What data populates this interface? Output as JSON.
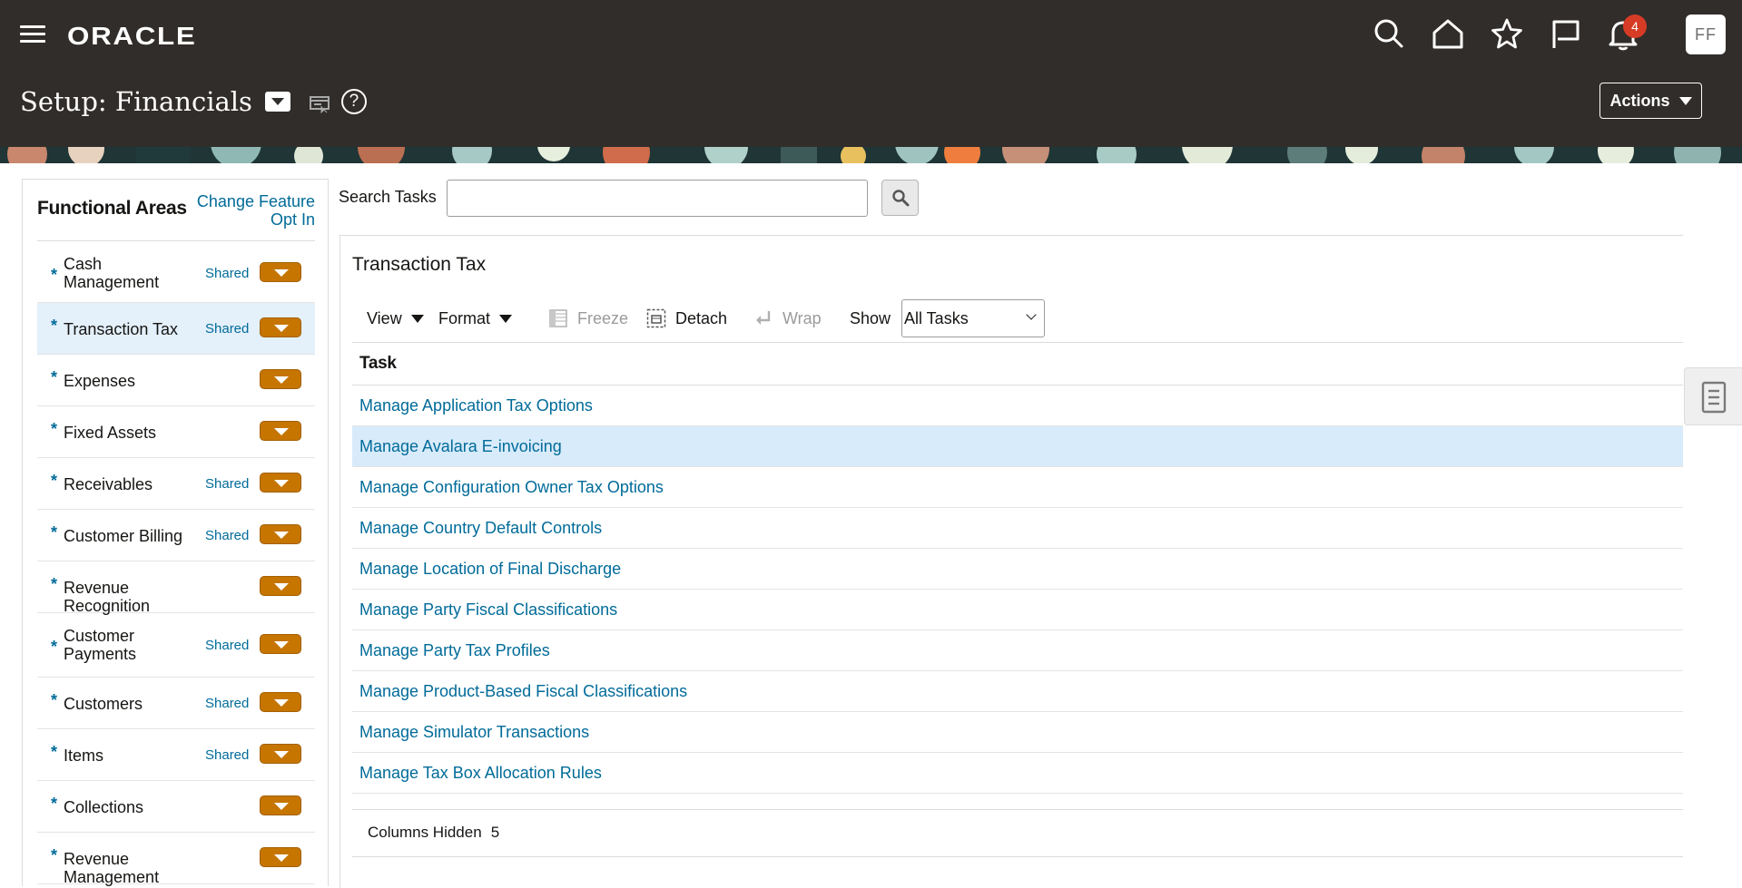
{
  "header": {
    "logo": "ORACLE",
    "notification_count": "4",
    "avatar_initials": "FF",
    "page_title": "Setup: Financials",
    "actions_label": "Actions"
  },
  "functional_areas": {
    "title": "Functional Areas",
    "change_link": "Change Feature Opt In",
    "items": [
      {
        "label": "Cash Management",
        "shared": "Shared",
        "star": "*"
      },
      {
        "label": "Transaction Tax",
        "shared": "Shared",
        "star": "*"
      },
      {
        "label": "Expenses",
        "shared": "",
        "star": "*"
      },
      {
        "label": "Fixed Assets",
        "shared": "",
        "star": "*"
      },
      {
        "label": "Receivables",
        "shared": "Shared",
        "star": "*"
      },
      {
        "label": "Customer Billing",
        "shared": "Shared",
        "star": "*"
      },
      {
        "label": "Revenue Recognition",
        "shared": "",
        "star": "*"
      },
      {
        "label": "Customer Payments",
        "shared": "Shared",
        "star": "*"
      },
      {
        "label": "Customers",
        "shared": "Shared",
        "star": "*"
      },
      {
        "label": "Items",
        "shared": "Shared",
        "star": "*"
      },
      {
        "label": "Collections",
        "shared": "",
        "star": "*"
      },
      {
        "label": "Revenue Management",
        "shared": "",
        "star": "*"
      }
    ]
  },
  "search": {
    "label": "Search Tasks",
    "value": "",
    "placeholder": ""
  },
  "section": {
    "title": "Transaction Tax"
  },
  "toolbar": {
    "view": "View",
    "format": "Format",
    "freeze": "Freeze",
    "detach": "Detach",
    "wrap": "Wrap",
    "show_label": "Show",
    "show_value": "All Tasks"
  },
  "table": {
    "column_header": "Task",
    "rows": [
      "Manage Application Tax Options",
      "Manage Avalara E-invoicing",
      "Manage Configuration Owner Tax Options",
      "Manage Country Default Controls",
      "Manage Location of Final Discharge",
      "Manage Party Fiscal Classifications",
      "Manage Party Tax Profiles",
      "Manage Product-Based Fiscal Classifications",
      "Manage Simulator Transactions",
      "Manage Tax Box Allocation Rules"
    ],
    "selected_row": 1,
    "footer_label": "Columns Hidden",
    "footer_count": "5"
  },
  "colors": {
    "header_bg": "#312d2a",
    "link": "#006b99",
    "accent_orange": "#c57500",
    "selected_bg": "#d8ebfa",
    "badge": "#d63b25"
  }
}
